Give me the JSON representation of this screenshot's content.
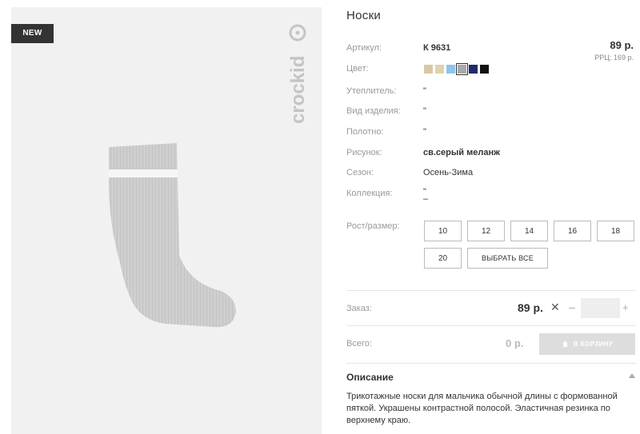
{
  "product": {
    "badge": "NEW",
    "brand": "crockid",
    "title": "Носки"
  },
  "pricing": {
    "price": "89 р.",
    "rrp_label": "РРЦ:",
    "rrp_value": "169 р."
  },
  "attributes": {
    "article": {
      "label": "Артикул:",
      "value": "К 9631"
    },
    "color": {
      "label": "Цвет:"
    },
    "insulation": {
      "label": "Утеплитель:",
      "value": "\""
    },
    "item_type": {
      "label": "Вид изделия:",
      "value": "\""
    },
    "fabric": {
      "label": "Полотно:",
      "value": "\""
    },
    "pattern": {
      "label": "Рисунок:",
      "value": "св.серый меланж"
    },
    "season": {
      "label": "Сезон:",
      "value": "Осень-Зима"
    },
    "collection": {
      "label": "Коллекция:",
      "value": "\"",
      "value2": "–"
    }
  },
  "colors": [
    {
      "hex": "#d8c9a6",
      "selected": false
    },
    {
      "hex": "#e0d2ad",
      "selected": false
    },
    {
      "hex": "#8ec5ee",
      "selected": false
    },
    {
      "hex": "#a9a9a9",
      "selected": true
    },
    {
      "hex": "#1d2b6a",
      "selected": false
    },
    {
      "hex": "#111111",
      "selected": false
    }
  ],
  "sizes": {
    "label": "Рост/размер:",
    "options": [
      "10",
      "12",
      "14",
      "16",
      "18",
      "20"
    ],
    "select_all": "ВЫБРАТЬ ВСЕ"
  },
  "order": {
    "label": "Заказ:",
    "price": "89 р.",
    "times": "✕",
    "minus": "–",
    "plus": "+",
    "quantity": ""
  },
  "total": {
    "label": "Всего:",
    "value": "0 р.",
    "cart_button": "В КОРЗИНУ"
  },
  "description": {
    "heading": "Описание",
    "text": "Трикотажные носки для мальчика обычной длины с формованной пяткой. Украшены контрастной полосой. Эластичная резинка по верхнему краю."
  }
}
